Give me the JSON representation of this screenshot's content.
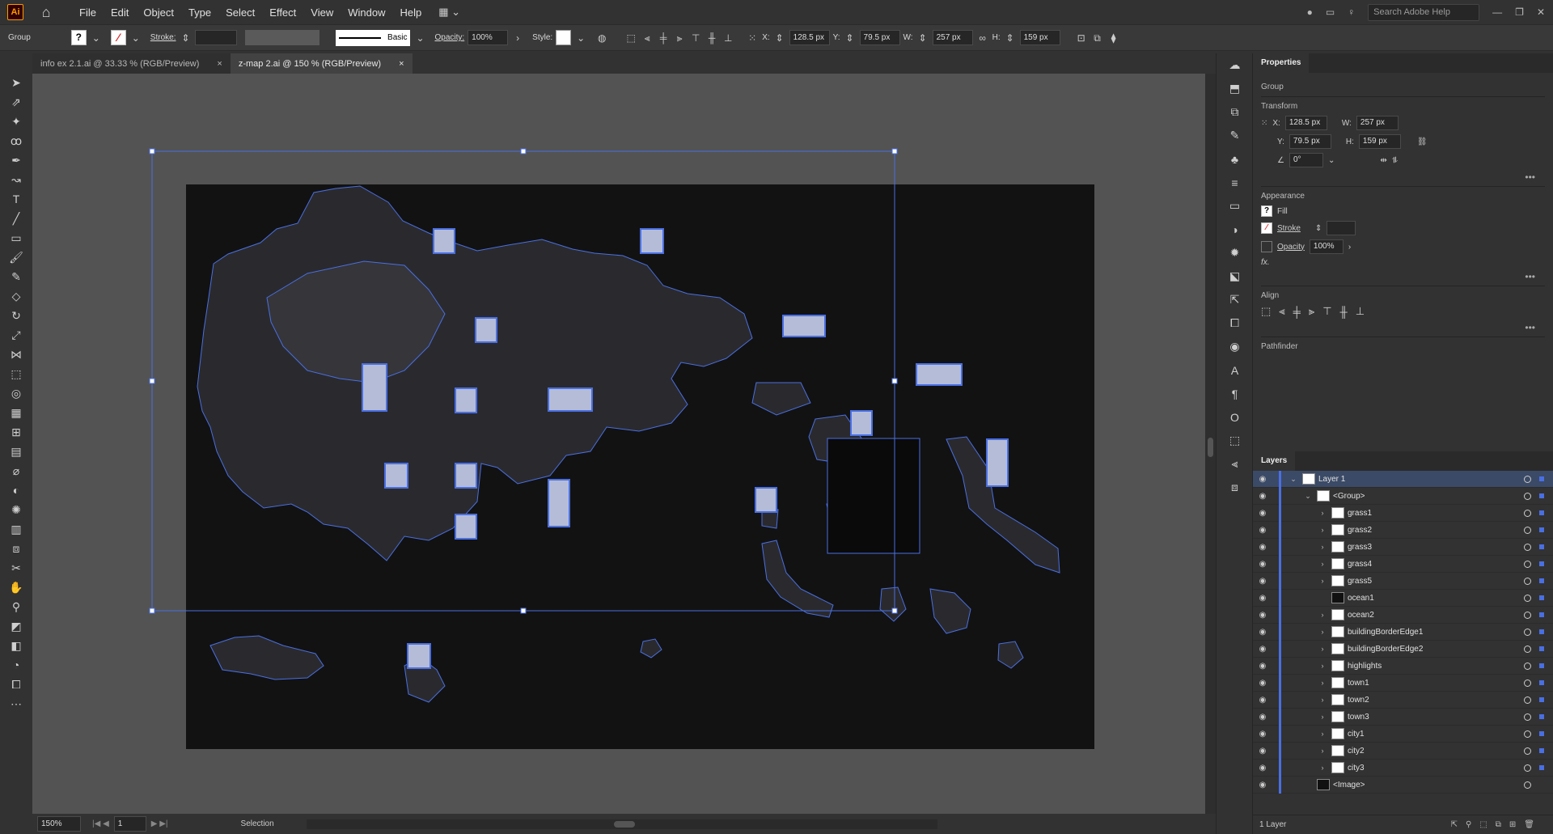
{
  "app": {
    "logo": "Ai",
    "home_icon": "⌂"
  },
  "menu": [
    "File",
    "Edit",
    "Object",
    "Type",
    "Select",
    "Effect",
    "View",
    "Window",
    "Help"
  ],
  "search": {
    "placeholder": "Search Adobe Help"
  },
  "control": {
    "selection_type": "Group",
    "stroke_label": "Stroke:",
    "brush": "Basic",
    "opacity_label": "Opacity:",
    "opacity": "100%",
    "style_label": "Style:",
    "x_label": "X:",
    "x": "128.5 px",
    "y_label": "Y:",
    "y": "79.5 px",
    "w_label": "W:",
    "w": "257 px",
    "h_label": "H:",
    "h": "159 px"
  },
  "tabs": [
    {
      "label": "info ex 2.1.ai @ 33.33 % (RGB/Preview)"
    },
    {
      "label": "z-map 2.ai @ 150 % (RGB/Preview)"
    }
  ],
  "status": {
    "zoom": "150%",
    "page": "1",
    "tool": "Selection"
  },
  "properties": {
    "tab": "Properties",
    "type": "Group",
    "transform_title": "Transform",
    "x_label": "X:",
    "x": "128.5 px",
    "y_label": "Y:",
    "y": "79.5 px",
    "w_label": "W:",
    "w": "257 px",
    "h_label": "H:",
    "h": "159 px",
    "angle": "0°",
    "appearance_title": "Appearance",
    "fill": "Fill",
    "stroke": "Stroke",
    "opacity_label": "Opacity",
    "opacity": "100%",
    "fx": "fx.",
    "align_title": "Align",
    "pathfinder_title": "Pathfinder"
  },
  "layers": {
    "tab": "Layers",
    "count": "1 Layer",
    "rows": [
      {
        "name": "Layer 1",
        "depth": 0,
        "chev": "⌄"
      },
      {
        "name": "<Group>",
        "depth": 1,
        "chev": "⌄"
      },
      {
        "name": "grass1",
        "depth": 2,
        "chev": "›"
      },
      {
        "name": "grass2",
        "depth": 2,
        "chev": "›"
      },
      {
        "name": "grass3",
        "depth": 2,
        "chev": "›"
      },
      {
        "name": "grass4",
        "depth": 2,
        "chev": "›"
      },
      {
        "name": "grass5",
        "depth": 2,
        "chev": "›"
      },
      {
        "name": "ocean1",
        "depth": 2,
        "chev": ""
      },
      {
        "name": "ocean2",
        "depth": 2,
        "chev": "›"
      },
      {
        "name": "buildingBorderEdge1",
        "depth": 2,
        "chev": "›"
      },
      {
        "name": "buildingBorderEdge2",
        "depth": 2,
        "chev": "›"
      },
      {
        "name": "highlights",
        "depth": 2,
        "chev": "›"
      },
      {
        "name": "town1",
        "depth": 2,
        "chev": "›"
      },
      {
        "name": "town2",
        "depth": 2,
        "chev": "›"
      },
      {
        "name": "town3",
        "depth": 2,
        "chev": "›"
      },
      {
        "name": "city1",
        "depth": 2,
        "chev": "›"
      },
      {
        "name": "city2",
        "depth": 2,
        "chev": "›"
      },
      {
        "name": "city3",
        "depth": 2,
        "chev": "›"
      },
      {
        "name": "<Image>",
        "depth": 1,
        "chev": ""
      }
    ]
  },
  "colors": {
    "selection": "#4a6fe3",
    "canvas": "#535353",
    "artboard": "#121212"
  }
}
